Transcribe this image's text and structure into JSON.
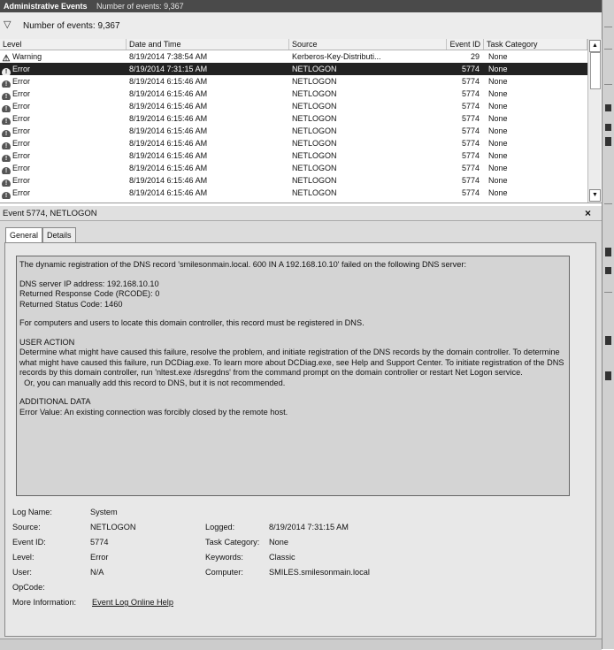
{
  "title": {
    "main": "Administrative Events",
    "sub": "Number of events: 9,367"
  },
  "filter": {
    "icon": "filter-icon",
    "text": "Number of events: 9,367"
  },
  "grid": {
    "columns": [
      "Level",
      "Date and Time",
      "Source",
      "Event ID",
      "Task Category"
    ],
    "rows": [
      {
        "level": "Warning",
        "date": "8/19/2014 7:38:54 AM",
        "source": "Kerberos-Key-Distributi...",
        "id": "29",
        "task": "None"
      },
      {
        "level": "Error",
        "date": "8/19/2014 7:31:15 AM",
        "source": "NETLOGON",
        "id": "5774",
        "task": "None"
      },
      {
        "level": "Error",
        "date": "8/19/2014 6:15:46 AM",
        "source": "NETLOGON",
        "id": "5774",
        "task": "None"
      },
      {
        "level": "Error",
        "date": "8/19/2014 6:15:46 AM",
        "source": "NETLOGON",
        "id": "5774",
        "task": "None"
      },
      {
        "level": "Error",
        "date": "8/19/2014 6:15:46 AM",
        "source": "NETLOGON",
        "id": "5774",
        "task": "None"
      },
      {
        "level": "Error",
        "date": "8/19/2014 6:15:46 AM",
        "source": "NETLOGON",
        "id": "5774",
        "task": "None"
      },
      {
        "level": "Error",
        "date": "8/19/2014 6:15:46 AM",
        "source": "NETLOGON",
        "id": "5774",
        "task": "None"
      },
      {
        "level": "Error",
        "date": "8/19/2014 6:15:46 AM",
        "source": "NETLOGON",
        "id": "5774",
        "task": "None"
      },
      {
        "level": "Error",
        "date": "8/19/2014 6:15:46 AM",
        "source": "NETLOGON",
        "id": "5774",
        "task": "None"
      },
      {
        "level": "Error",
        "date": "8/19/2014 6:15:46 AM",
        "source": "NETLOGON",
        "id": "5774",
        "task": "None"
      },
      {
        "level": "Error",
        "date": "8/19/2014 6:15:46 AM",
        "source": "NETLOGON",
        "id": "5774",
        "task": "None"
      },
      {
        "level": "Error",
        "date": "8/19/2014 6:15:46 AM",
        "source": "NETLOGON",
        "id": "5774",
        "task": "None"
      }
    ],
    "selected_index": 1
  },
  "detail": {
    "title": "Event 5774, NETLOGON",
    "close": "×",
    "tabs": [
      "General",
      "Details"
    ],
    "message": {
      "p1": "The dynamic registration of the DNS record 'smilesonmain.local. 600 IN A 192.168.10.10' failed on the following DNS server:",
      "p2a": "DNS server IP address: 192.168.10.10",
      "p2b": "Returned Response Code (RCODE): 0",
      "p2c": "Returned Status Code: 1460",
      "p3": "For computers and users to locate this domain controller, this record must be registered in DNS.",
      "p4h": "USER ACTION",
      "p4": "Determine what might have caused this failure, resolve the problem, and initiate registration of the DNS records by the domain controller. To determine what might have caused this failure, run DCDiag.exe. To learn more about DCDiag.exe, see Help and Support Center. To initiate registration of the DNS records by this domain  controller, run 'nltest.exe /dsregdns' from the command prompt on the domain controller or restart Net Logon service.",
      "p4b": "  Or, you can manually add this record to DNS, but it is not recommended.",
      "p5h": "ADDITIONAL DATA",
      "p5": "Error Value: An existing connection was forcibly closed by the remote host."
    },
    "info": {
      "log_name_label": "Log Name:",
      "log_name": "System",
      "source_label": "Source:",
      "source": "NETLOGON",
      "logged_label": "Logged:",
      "logged": "8/19/2014 7:31:15 AM",
      "event_id_label": "Event ID:",
      "event_id": "5774",
      "task_label": "Task Category:",
      "task": "None",
      "level_label": "Level:",
      "level": "Error",
      "keywords_label": "Keywords:",
      "keywords": "Classic",
      "user_label": "User:",
      "user": "N/A",
      "computer_label": "Computer:",
      "computer": "SMILES.smilesonmain.local",
      "opcode_label": "OpCode:",
      "opcode": "",
      "more_label": "More Information:",
      "more_link": "Event Log Online Help"
    }
  }
}
